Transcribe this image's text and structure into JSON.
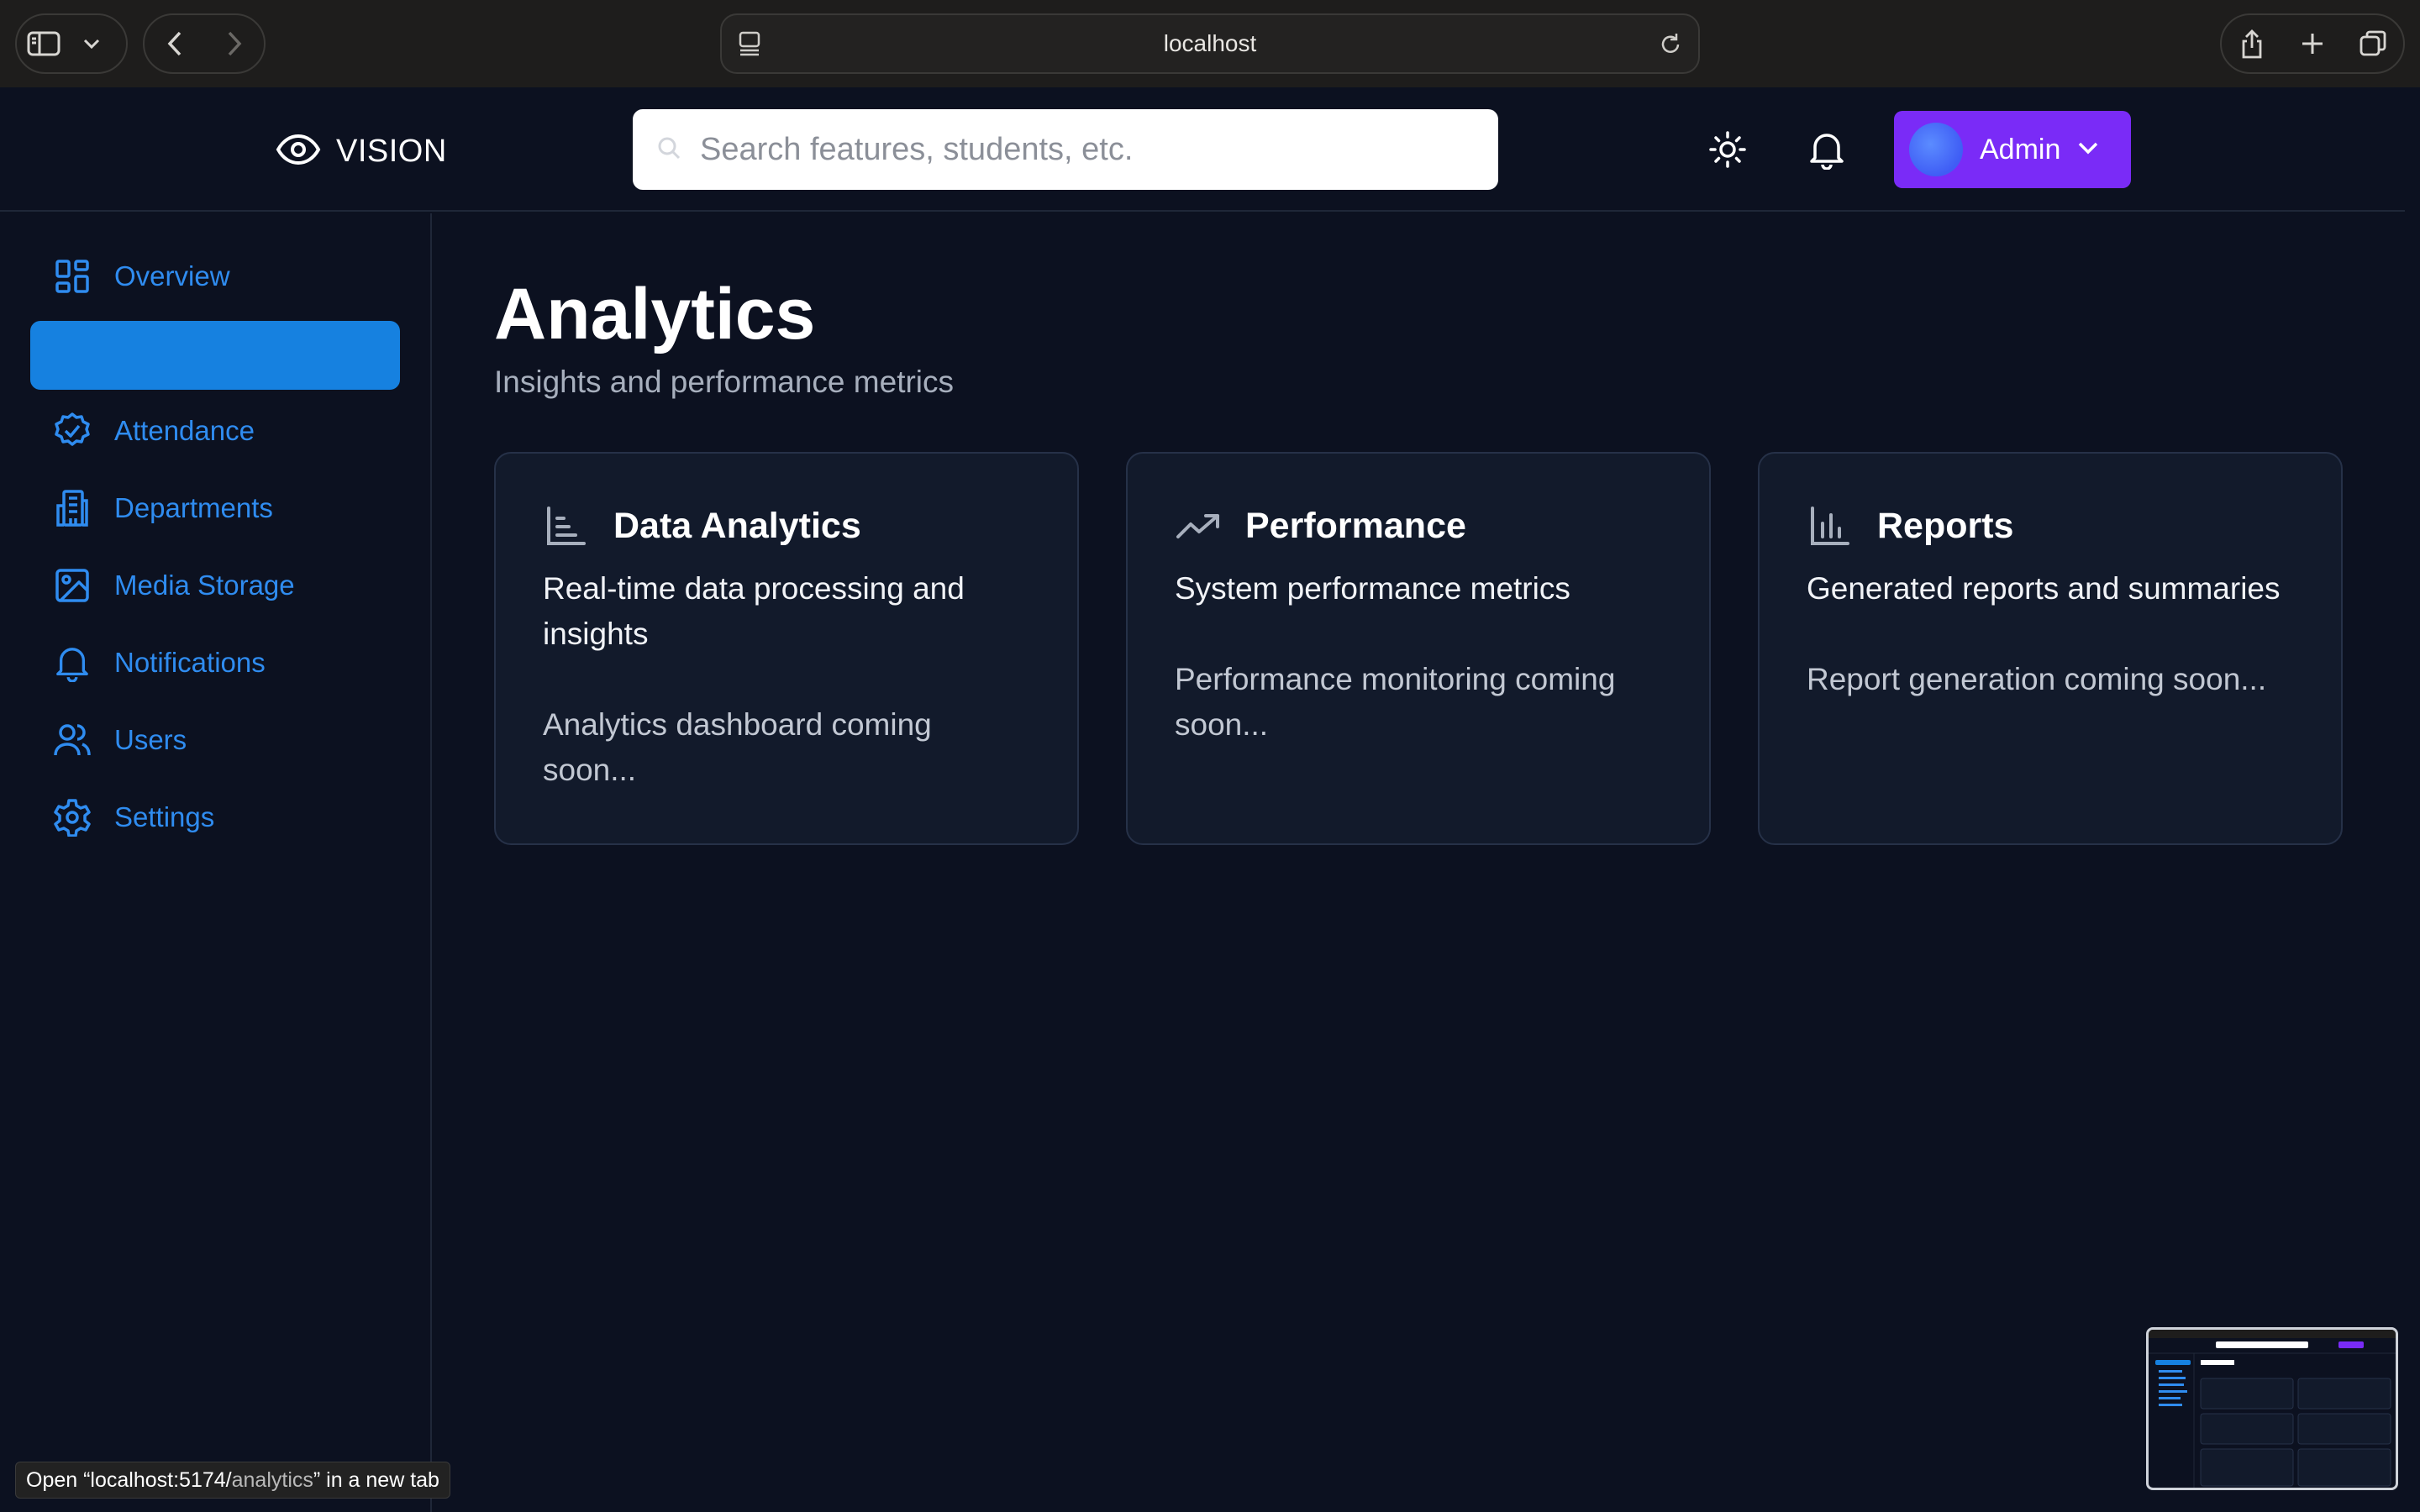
{
  "browser": {
    "url": "localhost",
    "status_prefix": "Open “localhost:5174/",
    "status_path": "analytics",
    "status_suffix": "” in a new tab"
  },
  "header": {
    "brand": "VISION",
    "search_placeholder": "Search features, students, etc.",
    "admin_label": "Admin"
  },
  "sidebar": {
    "items": [
      {
        "label": "Overview",
        "icon": "dashboard-icon",
        "active": false
      },
      {
        "label": "",
        "icon": "",
        "active": true
      },
      {
        "label": "Attendance",
        "icon": "badge-check-icon",
        "active": false
      },
      {
        "label": "Departments",
        "icon": "building-icon",
        "active": false
      },
      {
        "label": "Media Storage",
        "icon": "image-icon",
        "active": false
      },
      {
        "label": "Notifications",
        "icon": "bell-icon",
        "active": false
      },
      {
        "label": "Users",
        "icon": "users-icon",
        "active": false
      },
      {
        "label": "Settings",
        "icon": "gear-icon",
        "active": false
      }
    ]
  },
  "main": {
    "title": "Analytics",
    "subtitle": "Insights and performance metrics",
    "cards": [
      {
        "title": "Data Analytics",
        "icon": "bar-chart-icon",
        "description": "Real-time data processing and insights",
        "note": "Analytics dashboard coming soon..."
      },
      {
        "title": "Performance",
        "icon": "trending-up-icon",
        "description": "System performance metrics",
        "note": "Performance monitoring coming soon..."
      },
      {
        "title": "Reports",
        "icon": "column-chart-icon",
        "description": "Generated reports and summaries",
        "note": "Report generation coming soon..."
      }
    ]
  },
  "colors": {
    "background": "#0c1120",
    "accent_blue": "#1681e0",
    "nav_text": "#2f8cf0",
    "admin_purple": "#7a2bf7",
    "card_bg": "#121a2b"
  }
}
